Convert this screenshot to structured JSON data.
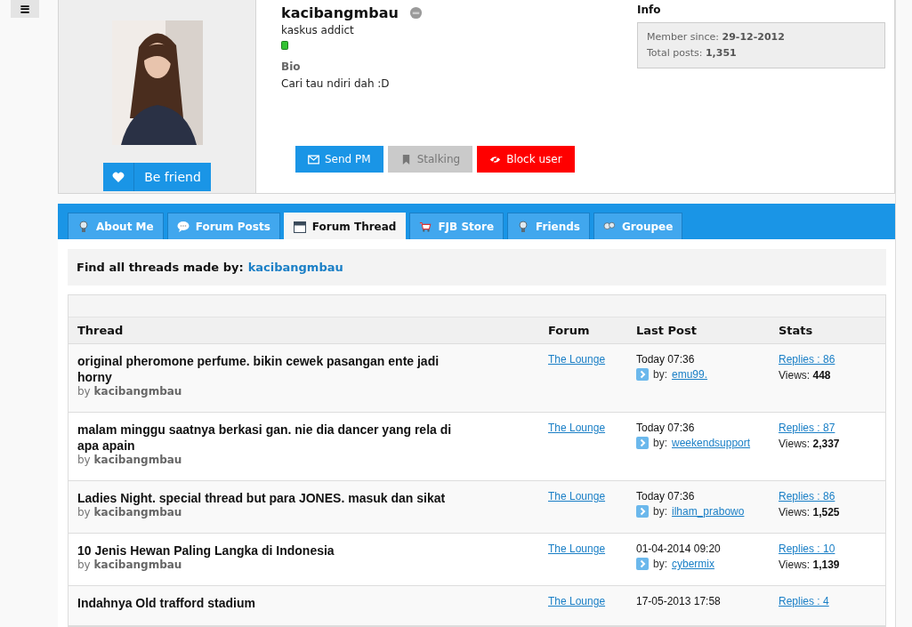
{
  "menu_button": {
    "label": "≡"
  },
  "profile": {
    "username": "kacibangmbau",
    "rank": "kaskus addict",
    "bio_heading": "Bio",
    "bio": "Cari tau ndiri dah :D",
    "friend_button": "Be friend",
    "info_heading": "Info",
    "info": [
      {
        "label": "Member since:",
        "value": "29-12-2012"
      },
      {
        "label": "Total posts:",
        "value": "1,351"
      }
    ],
    "actions": [
      {
        "label": "Send PM",
        "kind": "pm",
        "disabled": false
      },
      {
        "label": "Stalking",
        "kind": "stalk",
        "disabled": true
      },
      {
        "label": "Block user",
        "kind": "block",
        "disabled": false
      }
    ]
  },
  "tabs": [
    {
      "label": "About Me",
      "kind": "person",
      "selected": false
    },
    {
      "label": "Forum Posts",
      "kind": "bubble",
      "selected": false
    },
    {
      "label": "Forum Thread",
      "kind": "calendar",
      "selected": true
    },
    {
      "label": "FJB Store",
      "kind": "cart",
      "selected": false
    },
    {
      "label": "Friends",
      "kind": "person",
      "selected": false
    },
    {
      "label": "Groupee",
      "kind": "group",
      "selected": false
    }
  ],
  "find_bar": {
    "label": "Find all threads made by:",
    "user": "kacibangmbau"
  },
  "table": {
    "columns": [
      "Thread",
      "Forum",
      "Last Post",
      "Stats"
    ],
    "rows": [
      {
        "title": "original pheromone perfume. bikin cewek pasangan ente jadi horny",
        "by_label": "by",
        "author": "kacibangmbau",
        "forum": "The Lounge",
        "date": "Today 07:36",
        "by": "by:",
        "last_user": "emu99.",
        "replies": "Replies : 86",
        "views_label": "Views:",
        "views": "448"
      },
      {
        "title": "malam minggu saatnya berkasi gan. nie dia dancer yang rela di apa apain",
        "by_label": "by",
        "author": "kacibangmbau",
        "forum": "The Lounge",
        "date": "Today 07:36",
        "by": "by:",
        "last_user": "weekendsupport",
        "replies": "Replies : 87",
        "views_label": "Views:",
        "views": "2,337"
      },
      {
        "title": "Ladies Night. special thread but para JONES. masuk dan sikat",
        "by_label": "by",
        "author": "kacibangmbau",
        "forum": "The Lounge",
        "date": "Today 07:36",
        "by": "by:",
        "last_user": "ilham_prabowo",
        "replies": "Replies : 86",
        "views_label": "Views:",
        "views": "1,525"
      },
      {
        "title": "10 Jenis Hewan Paling Langka di Indonesia",
        "by_label": "by",
        "author": "kacibangmbau",
        "forum": "The Lounge",
        "date": "01-04-2014 09:20",
        "by": "by:",
        "last_user": "cybermix",
        "replies": "Replies : 10",
        "views_label": "Views:",
        "views": "1,139"
      },
      {
        "title": "Indahnya Old trafford stadium",
        "forum": "The Lounge",
        "date": "17-05-2013 17:58",
        "replies": "Replies : 4"
      }
    ]
  }
}
